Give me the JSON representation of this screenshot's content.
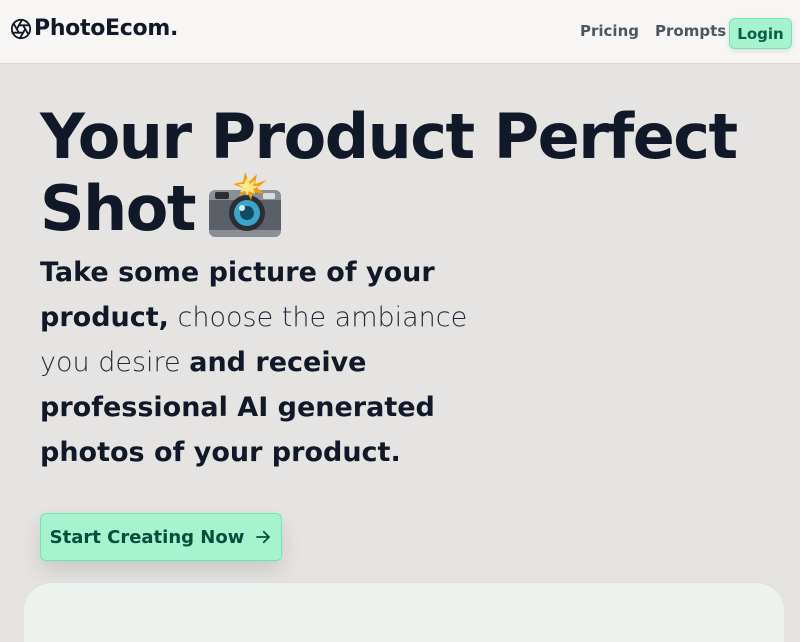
{
  "header": {
    "brand": "PhotoEcom.",
    "brand_icon": "aperture-icon",
    "nav": [
      {
        "label": "Pricing"
      },
      {
        "label": "Prompts"
      }
    ],
    "login_label": "Login",
    "accent": "#a7f3d0"
  },
  "hero": {
    "title_line1": "Your Product Perfect",
    "title_line2": "Shot",
    "title_icon": "camera-flash-icon",
    "sub": {
      "b1": "Take some picture of your product,",
      "t1": " choose the ambiance you desire ",
      "b2": "and receive professional AI generated photos of your product."
    },
    "cta_label": "Start Creating Now",
    "cta_icon": "arrow-right-icon"
  }
}
